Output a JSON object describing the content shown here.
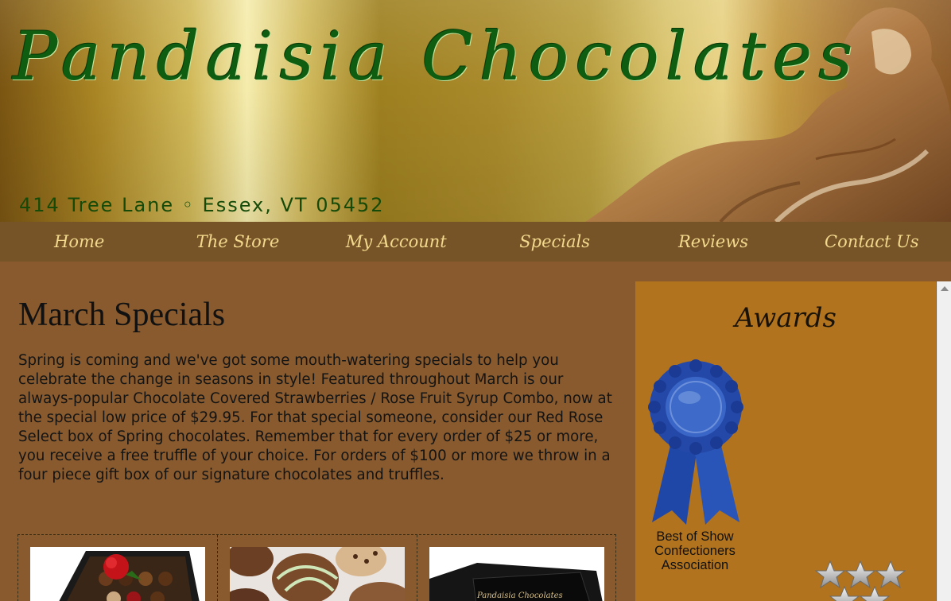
{
  "header": {
    "brand": "Pandaisia Chocolates",
    "address": "414 Tree Lane ◦ Essex, VT 05452"
  },
  "nav": {
    "items": [
      {
        "label": "Home"
      },
      {
        "label": "The Store"
      },
      {
        "label": "My Account"
      },
      {
        "label": "Specials"
      },
      {
        "label": "Reviews"
      },
      {
        "label": "Contact Us"
      }
    ]
  },
  "main": {
    "title": "March Specials",
    "intro": "Spring is coming and we've got some mouth-watering specials to help you celebrate the change in seasons in style! Featured throughout March is our always-popular Chocolate Covered Strawberries / Rose Fruit Syrup Combo, now at the special low price of $29.95. For that special someone, consider our Red Rose Select box of Spring chocolates. Remember that for every order of $25 or more, you receive a free truffle of your choice. For orders of $100 or more we throw in a four piece gift box of our signature chocolates and truffles."
  },
  "products": [
    {
      "icon": "chocolate-box-rose-image"
    },
    {
      "icon": "truffles-image"
    },
    {
      "icon": "black-gift-box-image",
      "box_text": "Pandaisia Chocolates"
    }
  ],
  "sidebar": {
    "title": "Awards",
    "award_caption": "Best of Show Confectioners Association",
    "rating_icon": "star-rating-icon"
  },
  "colors": {
    "page_bg": "#885a2e",
    "nav_bg": "#765427",
    "nav_text": "#f2d98d",
    "sidebar_bg": "#b1731e",
    "brand_green": "#0f5d10"
  }
}
